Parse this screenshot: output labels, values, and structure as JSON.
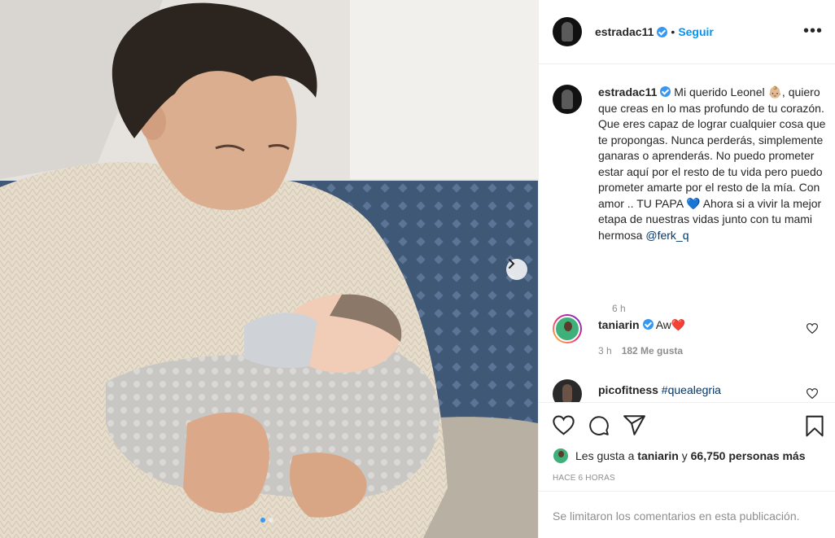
{
  "post": {
    "username": "estradac11",
    "follow_label": "Seguir",
    "bullet": "•",
    "more_label": "•••"
  },
  "caption": {
    "username": "estradac11",
    "text_before_emoji": "Mi querido Leonel",
    "emoji_baby": "👶🏼",
    "text_main": ", quiero que creas en lo mas profundo de tu corazón. Que eres capaz de lograr cualquier cosa que te propongas. Nunca perderás, simplemente ganaras o aprenderás. No puedo prometer estar aquí por el resto de tu vida pero puedo prometer amarte por el resto de la mía. Con amor .. TU PAPA",
    "emoji_heart": "💙",
    "text_after": " Ahora si a vivir la mejor etapa de nuestras vidas junto con tu mami hermosa ",
    "mention": "@ferk_q",
    "time": "6 h"
  },
  "comments": [
    {
      "username": "taniarin",
      "text": "Aw",
      "emoji": "❤️",
      "time": "3 h",
      "likes": "182 Me gusta"
    },
    {
      "username": "picofitness",
      "text": "#quealegria"
    }
  ],
  "likes_line": {
    "prefix": "Les gusta a",
    "user": "taniarin",
    "middle": "y",
    "count": "66,750 personas más"
  },
  "posted_time": "HACE 6 HORAS",
  "comments_limited": "Se limitaron los comentarios en esta publicación.",
  "colors": {
    "accent": "#0095f6",
    "verified": "#3897f0",
    "muted": "#8e8e8e",
    "heart_red": "#ed4956",
    "heart_blue": "#3897f0"
  },
  "icons": [
    "next-arrow-icon",
    "more-options-icon",
    "verified-icon",
    "heart-icon",
    "comment-icon",
    "share-icon",
    "bookmark-icon"
  ]
}
